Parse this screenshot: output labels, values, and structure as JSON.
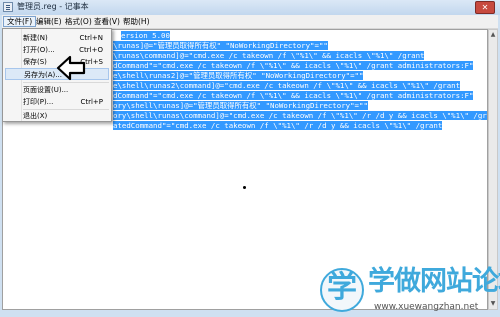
{
  "window": {
    "title": "管理员.reg - 记事本",
    "close_glyph": "✕"
  },
  "menubar": {
    "items": [
      "文件(F)",
      "编辑(E)",
      "格式(O)",
      "查看(V)",
      "帮助(H)"
    ]
  },
  "dropdown": {
    "items": [
      {
        "label": "新建(N)",
        "shortcut": "Ctrl+N"
      },
      {
        "label": "打开(O)...",
        "shortcut": "Ctrl+O"
      },
      {
        "label": "保存(S)",
        "shortcut": "Ctrl+S"
      },
      {
        "label": "另存为(A)...",
        "shortcut": ""
      },
      {
        "label": "页面设置(U)...",
        "shortcut": ""
      },
      {
        "label": "打印(P)...",
        "shortcut": "Ctrl+P"
      },
      {
        "label": "退出(X)",
        "shortcut": ""
      }
    ]
  },
  "editor": {
    "lines": [
      "ersion 5.00",
      "\\runas]@=\"管理员取得所有权\" \"NoWorkingDirectory\"=\"\"",
      "\\runas\\command]@=\"cmd.exe /c takeown /f \\\"%1\\\" && icacls \\\"%1\\\" /grant",
      "dCommand\"=\"cmd.exe /c takeown /f \\\"%1\\\" && icacls \\\"%1\\\" /grant administrators:F\"",
      "e\\shell\\runas2]@=\"管理员取得所有权\" \"NoWorkingDirectory\"=\"\"",
      "e\\shell\\runas2\\command]@=\"cmd.exe /c takeown /f \\\"%1\\\" && icacls \\\"%1\\\" /grant",
      "dCommand\"=\"cmd.exe /c takeown /f \\\"%1\\\" && icacls \\\"%1\\\" /grant administrators:F\"",
      "ory\\shell\\runas]@=\"管理员取得所有权\" \"NoWorkingDirectory\"=\"\"",
      "ory\\shell\\runas\\command]@=\"cmd.exe /c takeown /f \\\"%1\\\" /r /d y && icacls \\\"%1\\\" /grant",
      "atedCommand\"=\"cmd.exe /c takeown /f \\\"%1\\\" /r /d y && icacls \\\"%1\\\" /grant"
    ]
  },
  "scrollbar": {
    "up_glyph": "▲",
    "down_glyph": "▼"
  },
  "watermark": {
    "badge": "学",
    "text": "学做网站论坛",
    "url": "www.xuewangzhan.net"
  },
  "colors": {
    "selection": "#3399ff",
    "watermark": "#3fa9dc"
  }
}
